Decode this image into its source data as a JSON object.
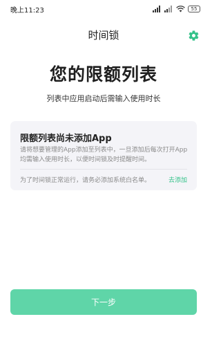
{
  "status_bar": {
    "time": "晚上11:23",
    "battery": "55"
  },
  "header": {
    "title": "时间锁",
    "settings_icon": "gear-icon"
  },
  "hero": {
    "title": "您的限额列表",
    "subtitle": "列表中应用启动后需输入使用时长"
  },
  "empty_card": {
    "title": "限额列表尚未添加App",
    "description": "请将想要管理的App添加至列表中，一旦添加后每次打开App均需输入使用时长，以便时间锁及时提醒时间。",
    "footer_text": "为了时间锁正常运行，请务必添加系统白名单。",
    "link_label": "去添加"
  },
  "footer": {
    "next_label": "下一步"
  },
  "colors": {
    "accent": "#35c28a",
    "button": "#5fd5a8",
    "card_bg": "#f4f4f8"
  }
}
